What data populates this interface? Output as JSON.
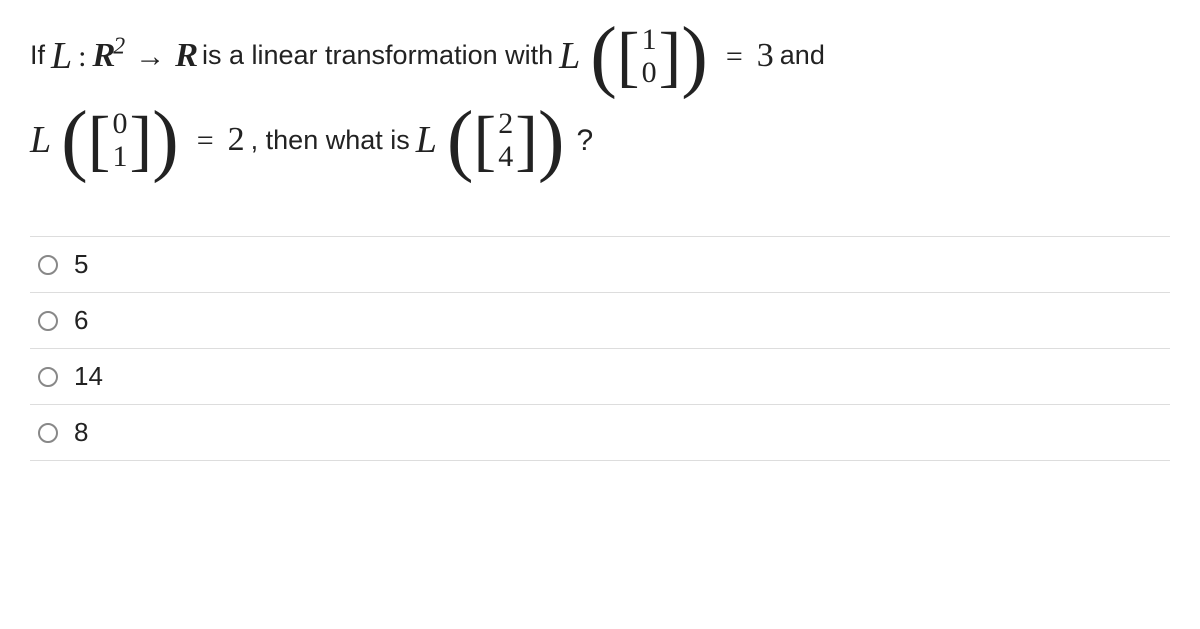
{
  "question": {
    "intro_if": "If",
    "map_domain_exp": "2",
    "text_is_linear": " is a linear transformation with ",
    "vec1_top": "1",
    "vec1_bot": "0",
    "val1": "3",
    "text_and": " and",
    "vec2_top": "0",
    "vec2_bot": "1",
    "val2": "2",
    "text_then": ", then what is ",
    "vec3_top": "2",
    "vec3_bot": "4",
    "qmark": "?"
  },
  "options": [
    {
      "label": "5"
    },
    {
      "label": "6"
    },
    {
      "label": "14"
    },
    {
      "label": "8"
    }
  ]
}
